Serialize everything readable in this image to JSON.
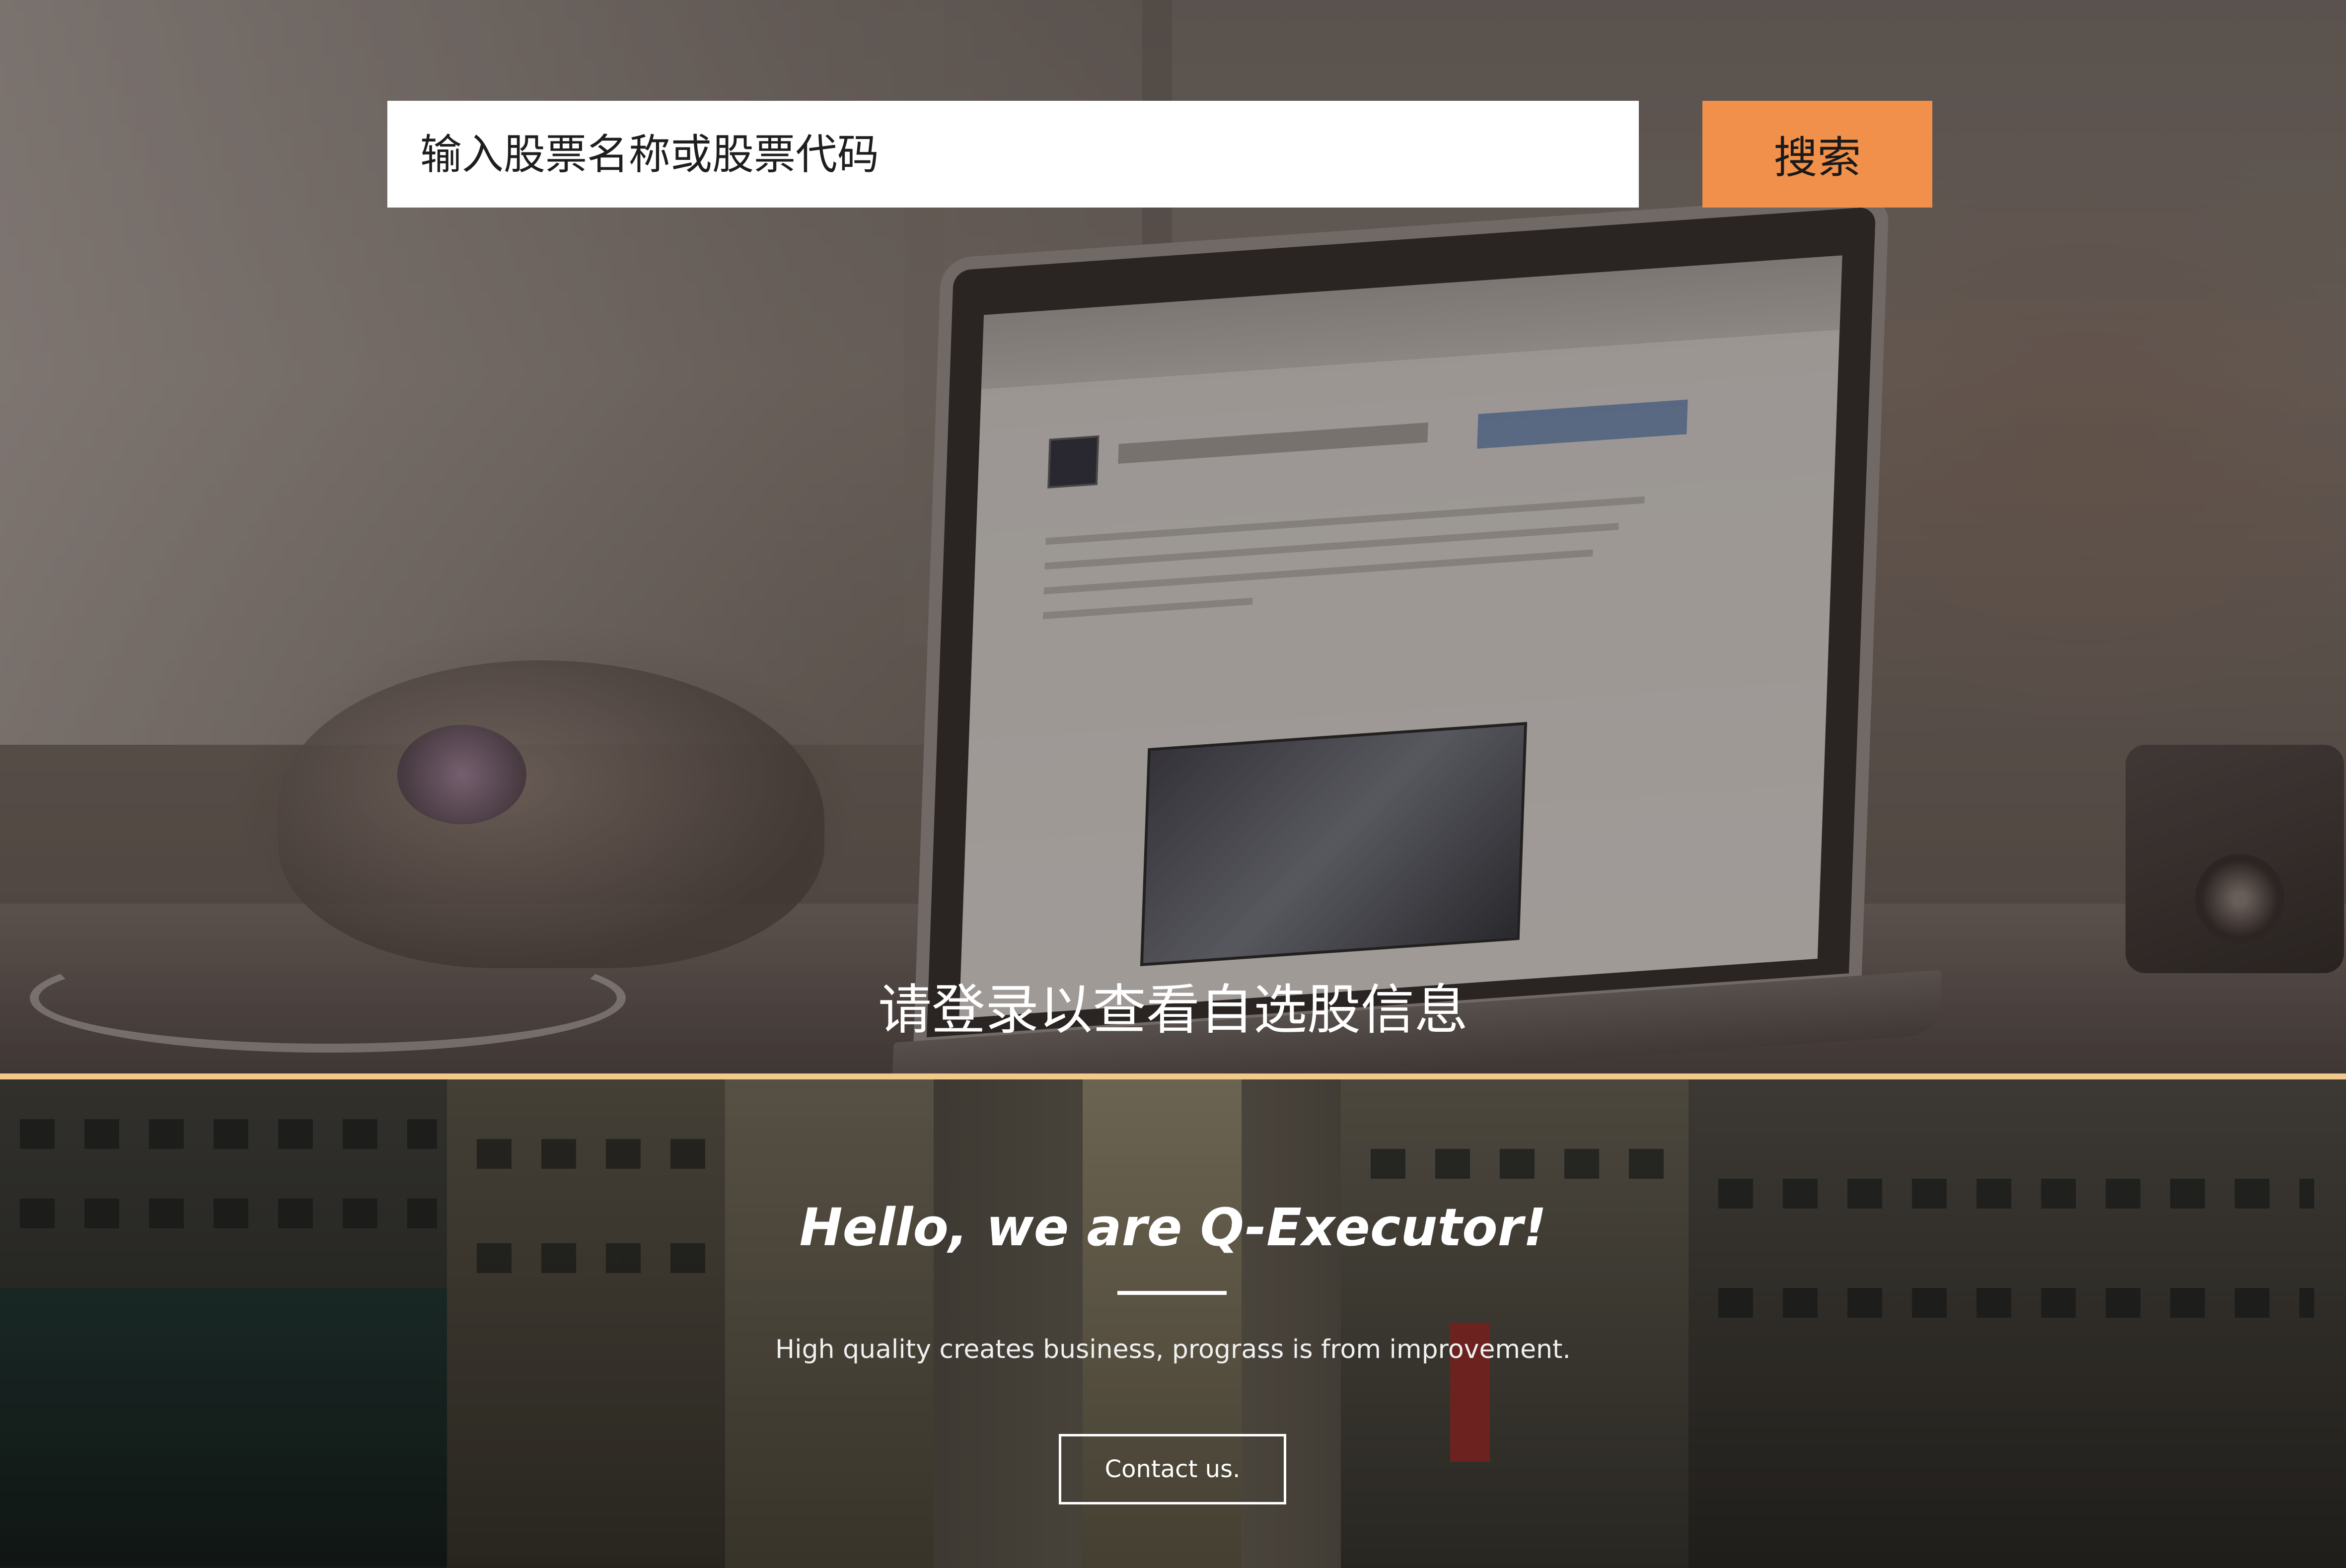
{
  "search": {
    "placeholder": "输入股票名称或股票代码",
    "button_label": "搜索"
  },
  "login_prompt": "请登录以查看自选股信息",
  "hero": {
    "title": "Hello, we are Q-Executor!",
    "subtitle": "High quality creates business, prograss is from improvement.",
    "contact_label": "Contact us."
  },
  "colors": {
    "accent": "#f0904a",
    "divider": "#f2c98a",
    "text_light": "#ffffff"
  },
  "icons": []
}
